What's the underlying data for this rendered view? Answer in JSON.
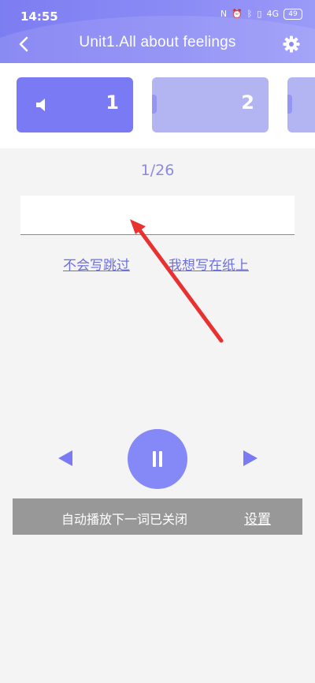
{
  "status_bar": {
    "time": "14:55",
    "battery": "49",
    "icons": [
      "nfc-icon",
      "alarm-icon",
      "bluetooth-icon",
      "vibrate-icon",
      "signal-4g-icon",
      "battery-icon"
    ]
  },
  "header": {
    "title": "Unit1.All about feelings",
    "back_icon": "chevron-left-icon",
    "settings_icon": "gear-icon"
  },
  "word_cards": [
    {
      "number": "1",
      "state": "active"
    },
    {
      "number": "2",
      "state": "inactive"
    }
  ],
  "progress": "1/26",
  "answer_input": {
    "value": "",
    "placeholder": ""
  },
  "links": {
    "skip": "不会写跳过",
    "write_on_paper": "我想写在纸上"
  },
  "toast": {
    "message": "自动播放下一词已关闭",
    "action": "设置"
  },
  "colors": {
    "accent": "#7a7af4",
    "card_inactive": "#b3b5f3",
    "annotation": "#e83232",
    "toast_bg": "#989898"
  }
}
